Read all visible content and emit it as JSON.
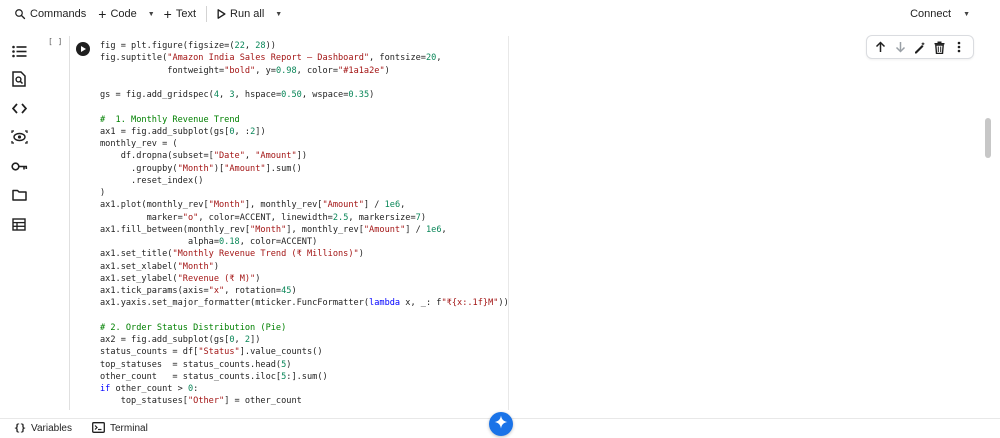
{
  "toolbar": {
    "commands_label": "Commands",
    "code_label": "Code",
    "text_label": "Text",
    "run_all_label": "Run all",
    "connect_label": "Connect"
  },
  "rail": {
    "icons": [
      "table-of-contents-icon",
      "find-icon",
      "code-snippets-icon",
      "variable-inspector-icon",
      "secrets-key-icon",
      "files-icon",
      "data-table-icon"
    ]
  },
  "cell": {
    "execution_count": "[ ]",
    "lines": [
      "fig = plt.figure(figsize=(22, 28))",
      "fig.suptitle(\"Amazon India Sales Report — Dashboard\", fontsize=20,",
      "             fontweight=\"bold\", y=0.98, color=\"#1a1a2e\")",
      "",
      "gs = fig.add_gridspec(4, 3, hspace=0.50, wspace=0.35)",
      "",
      "#  1. Monthly Revenue Trend",
      "ax1 = fig.add_subplot(gs[0, :2])",
      "monthly_rev = (",
      "    df.dropna(subset=[\"Date\", \"Amount\"])",
      "      .groupby(\"Month\")[\"Amount\"].sum()",
      "      .reset_index()",
      ")",
      "ax1.plot(monthly_rev[\"Month\"], monthly_rev[\"Amount\"] / 1e6,",
      "         marker=\"o\", color=ACCENT, linewidth=2.5, markersize=7)",
      "ax1.fill_between(monthly_rev[\"Month\"], monthly_rev[\"Amount\"] / 1e6,",
      "                 alpha=0.18, color=ACCENT)",
      "ax1.set_title(\"Monthly Revenue Trend (₹ Millions)\")",
      "ax1.set_xlabel(\"Month\")",
      "ax1.set_ylabel(\"Revenue (₹ M)\")",
      "ax1.tick_params(axis=\"x\", rotation=45)",
      "ax1.yaxis.set_major_formatter(mticker.FuncFormatter(lambda x, _: f\"₹{x:.1f}M\"))",
      "",
      "# 2. Order Status Distribution (Pie)",
      "ax2 = fig.add_subplot(gs[0, 2])",
      "status_counts = df[\"Status\"].value_counts()",
      "top_statuses  = status_counts.head(5)",
      "other_count   = status_counts.iloc[5:].sum()",
      "if other_count > 0:",
      "    top_statuses[\"Other\"] = other_count"
    ]
  },
  "cell_toolbar": {
    "icons": [
      "move-up-icon",
      "move-down-icon",
      "edit-icon",
      "delete-icon",
      "more-options-icon"
    ]
  },
  "bottombar": {
    "variables_label": "Variables",
    "terminal_label": "Terminal"
  }
}
